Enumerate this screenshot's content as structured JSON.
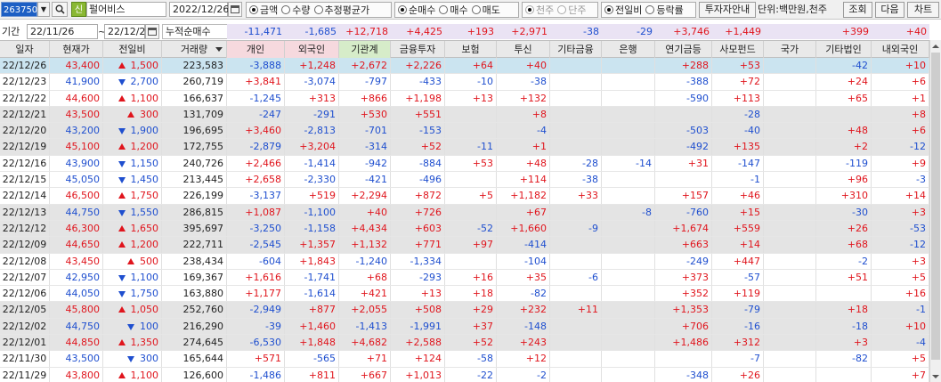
{
  "toolbar": {
    "stock_code": "263750",
    "credit_badge": "신",
    "stock_name": "펄어비스",
    "query_date": "2022/12/26",
    "radio_value": [
      {
        "label": "금액",
        "selected": true
      },
      {
        "label": "수량",
        "selected": false
      },
      {
        "label": "추정평균가",
        "selected": false
      }
    ],
    "radio_trade": [
      {
        "label": "순매수",
        "selected": true
      },
      {
        "label": "매수",
        "selected": false
      },
      {
        "label": "매도",
        "selected": false
      }
    ],
    "radio_unit": [
      {
        "label": "천주",
        "selected": true
      },
      {
        "label": "단주",
        "selected": false
      }
    ],
    "radio_compare": [
      {
        "label": "전일비",
        "selected": true
      },
      {
        "label": "등락률",
        "selected": false
      }
    ],
    "investor_guide_label": "투자자안내",
    "unit_text": "단위:백만원,천주",
    "query_button": "조회",
    "next_button": "다음",
    "chart_button": "차트"
  },
  "summary": {
    "label": "기간",
    "start_date": "22/11/26",
    "tilde": "~",
    "end_date": "22/12/26",
    "caption": "누적순매수",
    "values": {
      "individual": "-11,471",
      "foreign": "-1,685",
      "institution": "+12,718",
      "fin_invest": "+4,425",
      "insurance": "+193",
      "trust": "+2,971",
      "other_fin": "-38",
      "bank": "-29",
      "pension": "+3,746",
      "private_fund": "+1,449",
      "nation": "",
      "other_corp": "+399",
      "domestic_foreign": "+40"
    }
  },
  "columns": [
    {
      "key": "date",
      "label": "일자"
    },
    {
      "key": "price",
      "label": "현재가"
    },
    {
      "key": "change",
      "label": "전일비"
    },
    {
      "key": "volume",
      "label": "거래량"
    },
    {
      "key": "individual",
      "label": "개인"
    },
    {
      "key": "foreign",
      "label": "외국인"
    },
    {
      "key": "institution",
      "label": "기관계"
    },
    {
      "key": "fin_invest",
      "label": "금융투자"
    },
    {
      "key": "insurance",
      "label": "보험"
    },
    {
      "key": "trust",
      "label": "투신"
    },
    {
      "key": "other_fin",
      "label": "기타금융"
    },
    {
      "key": "bank",
      "label": "은행"
    },
    {
      "key": "pension",
      "label": "연기금등"
    },
    {
      "key": "private_fund",
      "label": "사모펀드"
    },
    {
      "key": "nation",
      "label": "국가"
    },
    {
      "key": "other_corp",
      "label": "기타법인"
    },
    {
      "key": "domestic_foreign",
      "label": "내외국인"
    }
  ],
  "rows": [
    {
      "date": "22/12/26",
      "price": "43,400",
      "dir": "up",
      "change": "1,500",
      "volume": "223,583",
      "individual": "-3,888",
      "foreign": "+1,248",
      "institution": "+2,672",
      "fin_invest": "+2,226",
      "insurance": "+64",
      "trust": "+40",
      "other_fin": "",
      "bank": "",
      "pension": "+288",
      "private_fund": "+53",
      "nation": "",
      "other_corp": "-42",
      "domestic_foreign": "+10",
      "style": "sel"
    },
    {
      "date": "22/12/23",
      "price": "41,900",
      "dir": "down",
      "change": "2,700",
      "volume": "260,719",
      "individual": "+3,841",
      "foreign": "-3,074",
      "institution": "-797",
      "fin_invest": "-433",
      "insurance": "-10",
      "trust": "-38",
      "other_fin": "",
      "bank": "",
      "pension": "-388",
      "private_fund": "+72",
      "nation": "",
      "other_corp": "+24",
      "domestic_foreign": "+6",
      "style": ""
    },
    {
      "date": "22/12/22",
      "price": "44,600",
      "dir": "up",
      "change": "1,100",
      "volume": "166,637",
      "individual": "-1,245",
      "foreign": "+313",
      "institution": "+866",
      "fin_invest": "+1,198",
      "insurance": "+13",
      "trust": "+132",
      "other_fin": "",
      "bank": "",
      "pension": "-590",
      "private_fund": "+113",
      "nation": "",
      "other_corp": "+65",
      "domestic_foreign": "+1",
      "style": ""
    },
    {
      "date": "22/12/21",
      "price": "43,500",
      "dir": "up",
      "change": "300",
      "volume": "131,709",
      "individual": "-247",
      "foreign": "-291",
      "institution": "+530",
      "fin_invest": "+551",
      "insurance": "",
      "trust": "+8",
      "other_fin": "",
      "bank": "",
      "pension": "",
      "private_fund": "-28",
      "nation": "",
      "other_corp": "",
      "domestic_foreign": "+8",
      "style": "grp"
    },
    {
      "date": "22/12/20",
      "price": "43,200",
      "dir": "down",
      "change": "1,900",
      "volume": "196,695",
      "individual": "+3,460",
      "foreign": "-2,813",
      "institution": "-701",
      "fin_invest": "-153",
      "insurance": "",
      "trust": "-4",
      "other_fin": "",
      "bank": "",
      "pension": "-503",
      "private_fund": "-40",
      "nation": "",
      "other_corp": "+48",
      "domestic_foreign": "+6",
      "style": "grp"
    },
    {
      "date": "22/12/19",
      "price": "45,100",
      "dir": "up",
      "change": "1,200",
      "volume": "172,755",
      "individual": "-2,879",
      "foreign": "+3,204",
      "institution": "-314",
      "fin_invest": "+52",
      "insurance": "-11",
      "trust": "+1",
      "other_fin": "",
      "bank": "",
      "pension": "-492",
      "private_fund": "+135",
      "nation": "",
      "other_corp": "+2",
      "domestic_foreign": "-12",
      "style": "grp"
    },
    {
      "date": "22/12/16",
      "price": "43,900",
      "dir": "down",
      "change": "1,150",
      "volume": "240,726",
      "individual": "+2,466",
      "foreign": "-1,414",
      "institution": "-942",
      "fin_invest": "-884",
      "insurance": "+53",
      "trust": "+48",
      "other_fin": "-28",
      "bank": "-14",
      "pension": "+31",
      "private_fund": "-147",
      "nation": "",
      "other_corp": "-119",
      "domestic_foreign": "+9",
      "style": ""
    },
    {
      "date": "22/12/15",
      "price": "45,050",
      "dir": "down",
      "change": "1,450",
      "volume": "213,445",
      "individual": "+2,658",
      "foreign": "-2,330",
      "institution": "-421",
      "fin_invest": "-496",
      "insurance": "",
      "trust": "+114",
      "other_fin": "-38",
      "bank": "",
      "pension": "",
      "private_fund": "-1",
      "nation": "",
      "other_corp": "+96",
      "domestic_foreign": "-3",
      "style": ""
    },
    {
      "date": "22/12/14",
      "price": "46,500",
      "dir": "up",
      "change": "1,750",
      "volume": "226,199",
      "individual": "-3,137",
      "foreign": "+519",
      "institution": "+2,294",
      "fin_invest": "+872",
      "insurance": "+5",
      "trust": "+1,182",
      "other_fin": "+33",
      "bank": "",
      "pension": "+157",
      "private_fund": "+46",
      "nation": "",
      "other_corp": "+310",
      "domestic_foreign": "+14",
      "style": ""
    },
    {
      "date": "22/12/13",
      "price": "44,750",
      "dir": "down",
      "change": "1,550",
      "volume": "286,815",
      "individual": "+1,087",
      "foreign": "-1,100",
      "institution": "+40",
      "fin_invest": "+726",
      "insurance": "",
      "trust": "+67",
      "other_fin": "",
      "bank": "-8",
      "pension": "-760",
      "private_fund": "+15",
      "nation": "",
      "other_corp": "-30",
      "domestic_foreign": "+3",
      "style": "grp"
    },
    {
      "date": "22/12/12",
      "price": "46,300",
      "dir": "up",
      "change": "1,650",
      "volume": "395,697",
      "individual": "-3,250",
      "foreign": "-1,158",
      "institution": "+4,434",
      "fin_invest": "+603",
      "insurance": "-52",
      "trust": "+1,660",
      "other_fin": "-9",
      "bank": "",
      "pension": "+1,674",
      "private_fund": "+559",
      "nation": "",
      "other_corp": "+26",
      "domestic_foreign": "-53",
      "style": "grp"
    },
    {
      "date": "22/12/09",
      "price": "44,650",
      "dir": "up",
      "change": "1,200",
      "volume": "222,711",
      "individual": "-2,545",
      "foreign": "+1,357",
      "institution": "+1,132",
      "fin_invest": "+771",
      "insurance": "+97",
      "trust": "-414",
      "other_fin": "",
      "bank": "",
      "pension": "+663",
      "private_fund": "+14",
      "nation": "",
      "other_corp": "+68",
      "domestic_foreign": "-12",
      "style": "grp"
    },
    {
      "date": "22/12/08",
      "price": "43,450",
      "dir": "up",
      "change": "500",
      "volume": "238,434",
      "individual": "-604",
      "foreign": "+1,843",
      "institution": "-1,240",
      "fin_invest": "-1,334",
      "insurance": "",
      "trust": "-104",
      "other_fin": "",
      "bank": "",
      "pension": "-249",
      "private_fund": "+447",
      "nation": "",
      "other_corp": "-2",
      "domestic_foreign": "+3",
      "style": ""
    },
    {
      "date": "22/12/07",
      "price": "42,950",
      "dir": "down",
      "change": "1,100",
      "volume": "169,367",
      "individual": "+1,616",
      "foreign": "-1,741",
      "institution": "+68",
      "fin_invest": "-293",
      "insurance": "+16",
      "trust": "+35",
      "other_fin": "-6",
      "bank": "",
      "pension": "+373",
      "private_fund": "-57",
      "nation": "",
      "other_corp": "+51",
      "domestic_foreign": "+5",
      "style": ""
    },
    {
      "date": "22/12/06",
      "price": "44,050",
      "dir": "down",
      "change": "1,750",
      "volume": "163,880",
      "individual": "+1,177",
      "foreign": "-1,614",
      "institution": "+421",
      "fin_invest": "+13",
      "insurance": "+18",
      "trust": "-82",
      "other_fin": "",
      "bank": "",
      "pension": "+352",
      "private_fund": "+119",
      "nation": "",
      "other_corp": "",
      "domestic_foreign": "+16",
      "style": ""
    },
    {
      "date": "22/12/05",
      "price": "45,800",
      "dir": "up",
      "change": "1,050",
      "volume": "252,760",
      "individual": "-2,949",
      "foreign": "+877",
      "institution": "+2,055",
      "fin_invest": "+508",
      "insurance": "+29",
      "trust": "+232",
      "other_fin": "+11",
      "bank": "",
      "pension": "+1,353",
      "private_fund": "-79",
      "nation": "",
      "other_corp": "+18",
      "domestic_foreign": "-1",
      "style": "grp"
    },
    {
      "date": "22/12/02",
      "price": "44,750",
      "dir": "down",
      "change": "100",
      "volume": "216,290",
      "individual": "-39",
      "foreign": "+1,460",
      "institution": "-1,413",
      "fin_invest": "-1,991",
      "insurance": "+37",
      "trust": "-148",
      "other_fin": "",
      "bank": "",
      "pension": "+706",
      "private_fund": "-16",
      "nation": "",
      "other_corp": "-18",
      "domestic_foreign": "+10",
      "style": "grp"
    },
    {
      "date": "22/12/01",
      "price": "44,850",
      "dir": "up",
      "change": "1,350",
      "volume": "274,645",
      "individual": "-6,530",
      "foreign": "+1,848",
      "institution": "+4,682",
      "fin_invest": "+2,588",
      "insurance": "+52",
      "trust": "+243",
      "other_fin": "",
      "bank": "",
      "pension": "+1,486",
      "private_fund": "+312",
      "nation": "",
      "other_corp": "+3",
      "domestic_foreign": "-4",
      "style": "grp"
    },
    {
      "date": "22/11/30",
      "price": "43,500",
      "dir": "down",
      "change": "300",
      "volume": "165,644",
      "individual": "+571",
      "foreign": "-565",
      "institution": "+71",
      "fin_invest": "+124",
      "insurance": "-58",
      "trust": "+12",
      "other_fin": "",
      "bank": "",
      "pension": "",
      "private_fund": "-7",
      "nation": "",
      "other_corp": "-82",
      "domestic_foreign": "+5",
      "style": ""
    },
    {
      "date": "22/11/29",
      "price": "43,800",
      "dir": "up",
      "change": "1,100",
      "volume": "126,600",
      "individual": "-1,486",
      "foreign": "+811",
      "institution": "+667",
      "fin_invest": "+1,013",
      "insurance": "-22",
      "trust": "-2",
      "other_fin": "",
      "bank": "",
      "pension": "-348",
      "private_fund": "+26",
      "nation": "",
      "other_corp": "",
      "domestic_foreign": "+7",
      "style": ""
    }
  ],
  "colors": {
    "up": "#e0151d",
    "down": "#1f4fcf",
    "selected_row": "#cbe4f0",
    "group_row": "#e4e4e4",
    "summary_bg": "#eae3f4"
  }
}
